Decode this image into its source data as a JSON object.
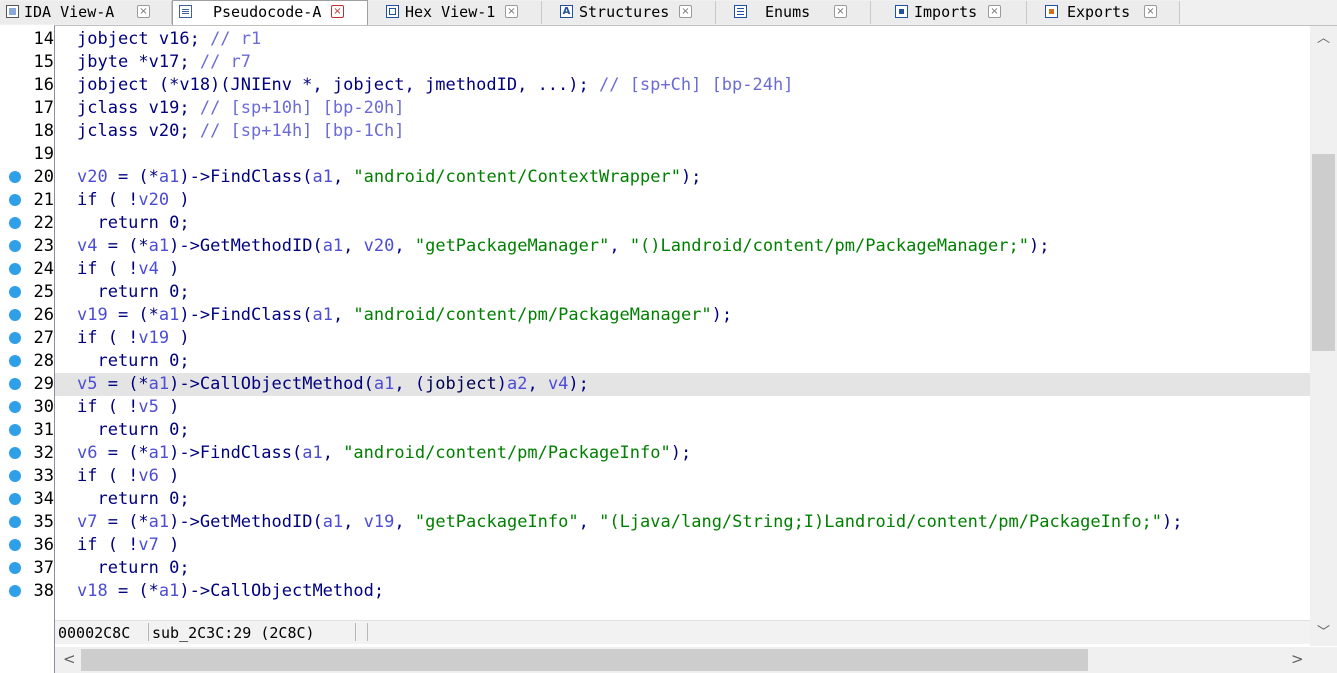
{
  "tabs": [
    {
      "label": "IDA View-A",
      "icon": "ida-view-icon",
      "close": "×",
      "active": false
    },
    {
      "label": "Pseudocode-A",
      "icon": "pseudocode-icon",
      "close": "×",
      "active": true
    },
    {
      "label": "Hex View-1",
      "icon": "hex-view-icon",
      "close": "×",
      "active": false
    },
    {
      "label": "Structures",
      "icon": "structures-icon",
      "close": "×",
      "active": false
    },
    {
      "label": "Enums",
      "icon": "enums-icon",
      "close": "×",
      "active": false
    },
    {
      "label": "Imports",
      "icon": "imports-icon",
      "close": "×",
      "active": false
    },
    {
      "label": "Exports",
      "icon": "exports-icon",
      "close": "×",
      "active": false
    }
  ],
  "structures_icon_glyph": "A",
  "gutter": {
    "line_numbers": [
      "14",
      "15",
      "16",
      "17",
      "18",
      "19",
      "20",
      "21",
      "22",
      "23",
      "24",
      "25",
      "26",
      "27",
      "28",
      "29",
      "30",
      "31",
      "32",
      "33",
      "34",
      "35",
      "36",
      "37",
      "38"
    ],
    "breakpoint_dots": [
      false,
      false,
      false,
      false,
      false,
      false,
      true,
      true,
      true,
      true,
      true,
      true,
      true,
      true,
      true,
      true,
      true,
      true,
      true,
      true,
      true,
      true,
      true,
      true,
      true
    ],
    "dot_color": "#2f9fe8"
  },
  "code": {
    "highlighted_line": "29",
    "lines": [
      [
        {
          "t": "jobject v16; ",
          "c": "k"
        },
        {
          "t": "// r1",
          "c": "c"
        }
      ],
      [
        {
          "t": "jbyte *v17; ",
          "c": "k"
        },
        {
          "t": "// r7",
          "c": "c"
        }
      ],
      [
        {
          "t": "jobject (*v18)(JNIEnv *, jobject, jmethodID, ...); ",
          "c": "k"
        },
        {
          "t": "// [sp+Ch] [bp-24h]",
          "c": "c"
        }
      ],
      [
        {
          "t": "jclass v19; ",
          "c": "k"
        },
        {
          "t": "// [sp+10h] [bp-20h]",
          "c": "c"
        }
      ],
      [
        {
          "t": "jclass v20; ",
          "c": "k"
        },
        {
          "t": "// [sp+14h] [bp-1Ch]",
          "c": "c"
        }
      ],
      [],
      [
        {
          "t": "v20",
          "c": "v"
        },
        {
          "t": " = (*",
          "c": "k"
        },
        {
          "t": "a1",
          "c": "v"
        },
        {
          "t": ")->FindClass(",
          "c": "k"
        },
        {
          "t": "a1",
          "c": "v"
        },
        {
          "t": ", ",
          "c": "k"
        },
        {
          "t": "\"android/content/ContextWrapper\"",
          "c": "s"
        },
        {
          "t": ");",
          "c": "k"
        }
      ],
      [
        {
          "t": "if ( !",
          "c": "k"
        },
        {
          "t": "v20",
          "c": "v"
        },
        {
          "t": " )",
          "c": "k"
        }
      ],
      [
        {
          "t": "  return 0;",
          "c": "k"
        }
      ],
      [
        {
          "t": "v4",
          "c": "v"
        },
        {
          "t": " = (*",
          "c": "k"
        },
        {
          "t": "a1",
          "c": "v"
        },
        {
          "t": ")->GetMethodID(",
          "c": "k"
        },
        {
          "t": "a1",
          "c": "v"
        },
        {
          "t": ", ",
          "c": "k"
        },
        {
          "t": "v20",
          "c": "v"
        },
        {
          "t": ", ",
          "c": "k"
        },
        {
          "t": "\"getPackageManager\"",
          "c": "s"
        },
        {
          "t": ", ",
          "c": "k"
        },
        {
          "t": "\"()Landroid/content/pm/PackageManager;\"",
          "c": "s"
        },
        {
          "t": ");",
          "c": "k"
        }
      ],
      [
        {
          "t": "if ( !",
          "c": "k"
        },
        {
          "t": "v4",
          "c": "v"
        },
        {
          "t": " )",
          "c": "k"
        }
      ],
      [
        {
          "t": "  return 0;",
          "c": "k"
        }
      ],
      [
        {
          "t": "v19",
          "c": "v"
        },
        {
          "t": " = (*",
          "c": "k"
        },
        {
          "t": "a1",
          "c": "v"
        },
        {
          "t": ")->FindClass(",
          "c": "k"
        },
        {
          "t": "a1",
          "c": "v"
        },
        {
          "t": ", ",
          "c": "k"
        },
        {
          "t": "\"android/content/pm/PackageManager\"",
          "c": "s"
        },
        {
          "t": ");",
          "c": "k"
        }
      ],
      [
        {
          "t": "if ( !",
          "c": "k"
        },
        {
          "t": "v19",
          "c": "v"
        },
        {
          "t": " )",
          "c": "k"
        }
      ],
      [
        {
          "t": "  return 0;",
          "c": "k"
        }
      ],
      [
        {
          "t": "v5",
          "c": "v"
        },
        {
          "t": " = (*",
          "c": "k"
        },
        {
          "t": "a1",
          "c": "v"
        },
        {
          "t": ")->CallObjectMethod(",
          "c": "k"
        },
        {
          "t": "a1",
          "c": "v"
        },
        {
          "t": ", (",
          "c": "k"
        },
        {
          "t": "jobject",
          "c": "f"
        },
        {
          "t": ")",
          "c": "k"
        },
        {
          "t": "a2",
          "c": "v"
        },
        {
          "t": ", ",
          "c": "k"
        },
        {
          "t": "v4",
          "c": "v"
        },
        {
          "t": ");",
          "c": "k"
        }
      ],
      [
        {
          "t": "if ( !",
          "c": "k"
        },
        {
          "t": "v5",
          "c": "v"
        },
        {
          "t": " )",
          "c": "k"
        }
      ],
      [
        {
          "t": "  return 0;",
          "c": "k"
        }
      ],
      [
        {
          "t": "v6",
          "c": "v"
        },
        {
          "t": " = (*",
          "c": "k"
        },
        {
          "t": "a1",
          "c": "v"
        },
        {
          "t": ")->FindClass(",
          "c": "k"
        },
        {
          "t": "a1",
          "c": "v"
        },
        {
          "t": ", ",
          "c": "k"
        },
        {
          "t": "\"android/content/pm/PackageInfo\"",
          "c": "s"
        },
        {
          "t": ");",
          "c": "k"
        }
      ],
      [
        {
          "t": "if ( !",
          "c": "k"
        },
        {
          "t": "v6",
          "c": "v"
        },
        {
          "t": " )",
          "c": "k"
        }
      ],
      [
        {
          "t": "  return 0;",
          "c": "k"
        }
      ],
      [
        {
          "t": "v7",
          "c": "v"
        },
        {
          "t": " = (*",
          "c": "k"
        },
        {
          "t": "a1",
          "c": "v"
        },
        {
          "t": ")->GetMethodID(",
          "c": "k"
        },
        {
          "t": "a1",
          "c": "v"
        },
        {
          "t": ", ",
          "c": "k"
        },
        {
          "t": "v19",
          "c": "v"
        },
        {
          "t": ", ",
          "c": "k"
        },
        {
          "t": "\"getPackageInfo\"",
          "c": "s"
        },
        {
          "t": ", ",
          "c": "k"
        },
        {
          "t": "\"(Ljava/lang/String;I)Landroid/content/pm/PackageInfo;\"",
          "c": "s"
        },
        {
          "t": ");",
          "c": "k"
        }
      ],
      [
        {
          "t": "if ( !",
          "c": "k"
        },
        {
          "t": "v7",
          "c": "v"
        },
        {
          "t": " )",
          "c": "k"
        }
      ],
      [
        {
          "t": "  return 0;",
          "c": "k"
        }
      ],
      [
        {
          "t": "v18",
          "c": "v"
        },
        {
          "t": " = (*",
          "c": "k"
        },
        {
          "t": "a1",
          "c": "v"
        },
        {
          "t": ")->CallObjectMethod;",
          "c": "k"
        }
      ]
    ]
  },
  "status": {
    "address": "00002C8C",
    "location": "sub_2C3C:29 (2C8C)"
  },
  "scrollbars": {
    "up_arrow": "︿",
    "down_arrow": "﹀",
    "left_arrow": "<",
    "right_arrow": ">"
  },
  "colors": {
    "keyword": "#00007f",
    "variable": "#4c4cd6",
    "comment": "#6b6bd8",
    "string": "#008000",
    "highlight": "#e4e4e4"
  }
}
